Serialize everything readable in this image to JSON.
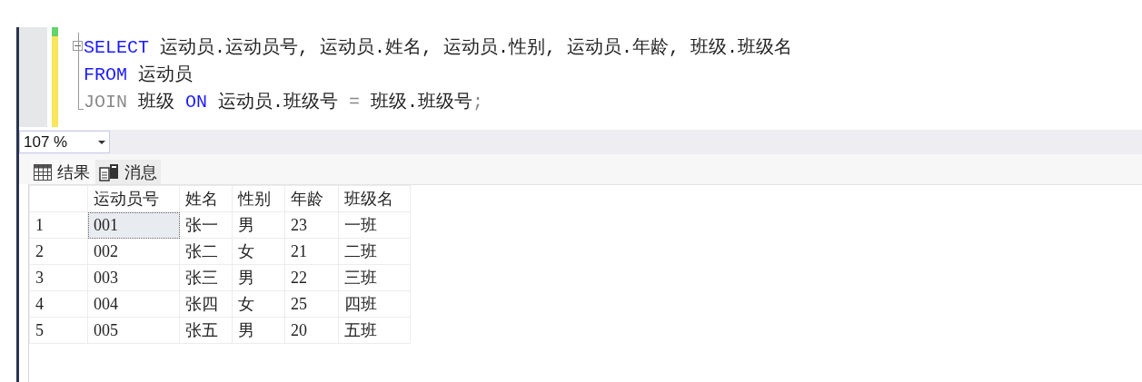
{
  "editor": {
    "lines": [
      {
        "fold_start": true,
        "fold_end": false,
        "tokens": [
          {
            "kind": "keyword",
            "text": "SELECT"
          },
          {
            "kind": "plain",
            "text": " 运动员.运动员号, 运动员.姓名, 运动员.性别, 运动员.年龄, 班级.班级名"
          }
        ]
      },
      {
        "fold_start": false,
        "fold_end": false,
        "tokens": [
          {
            "kind": "keyword",
            "text": "FROM"
          },
          {
            "kind": "plain",
            "text": " 运动员"
          }
        ]
      },
      {
        "fold_start": false,
        "fold_end": true,
        "tokens": [
          {
            "kind": "operator",
            "text": "JOIN"
          },
          {
            "kind": "plain",
            "text": " 班级 "
          },
          {
            "kind": "keyword",
            "text": "ON"
          },
          {
            "kind": "plain",
            "text": " 运动员.班级号 "
          },
          {
            "kind": "operator",
            "text": "="
          },
          {
            "kind": "plain",
            "text": " 班级.班级号"
          },
          {
            "kind": "operator",
            "text": ";"
          }
        ]
      }
    ]
  },
  "zoom": {
    "value": "107 %"
  },
  "result_tabs": [
    {
      "kind": "grid",
      "label": "结果",
      "selected": true
    },
    {
      "kind": "messages",
      "label": "消息",
      "selected": false
    }
  ],
  "grid": {
    "columns": [
      "运动员号",
      "姓名",
      "性别",
      "年龄",
      "班级名"
    ],
    "rows": [
      {
        "number": "1",
        "cells": [
          {
            "text": "001",
            "selected": true
          },
          {
            "text": "张一",
            "selected": false
          },
          {
            "text": "男",
            "selected": false
          },
          {
            "text": "23",
            "selected": false
          },
          {
            "text": "一班",
            "selected": false
          }
        ]
      },
      {
        "number": "2",
        "cells": [
          {
            "text": "002",
            "selected": false
          },
          {
            "text": "张二",
            "selected": false
          },
          {
            "text": "女",
            "selected": false
          },
          {
            "text": "21",
            "selected": false
          },
          {
            "text": "二班",
            "selected": false
          }
        ]
      },
      {
        "number": "3",
        "cells": [
          {
            "text": "003",
            "selected": false
          },
          {
            "text": "张三",
            "selected": false
          },
          {
            "text": "男",
            "selected": false
          },
          {
            "text": "22",
            "selected": false
          },
          {
            "text": "三班",
            "selected": false
          }
        ]
      },
      {
        "number": "4",
        "cells": [
          {
            "text": "004",
            "selected": false
          },
          {
            "text": "张四",
            "selected": false
          },
          {
            "text": "女",
            "selected": false
          },
          {
            "text": "25",
            "selected": false
          },
          {
            "text": "四班",
            "selected": false
          }
        ]
      },
      {
        "number": "5",
        "cells": [
          {
            "text": "005",
            "selected": false
          },
          {
            "text": "张五",
            "selected": false
          },
          {
            "text": "男",
            "selected": false
          },
          {
            "text": "20",
            "selected": false
          },
          {
            "text": "五班",
            "selected": false
          }
        ]
      }
    ]
  }
}
